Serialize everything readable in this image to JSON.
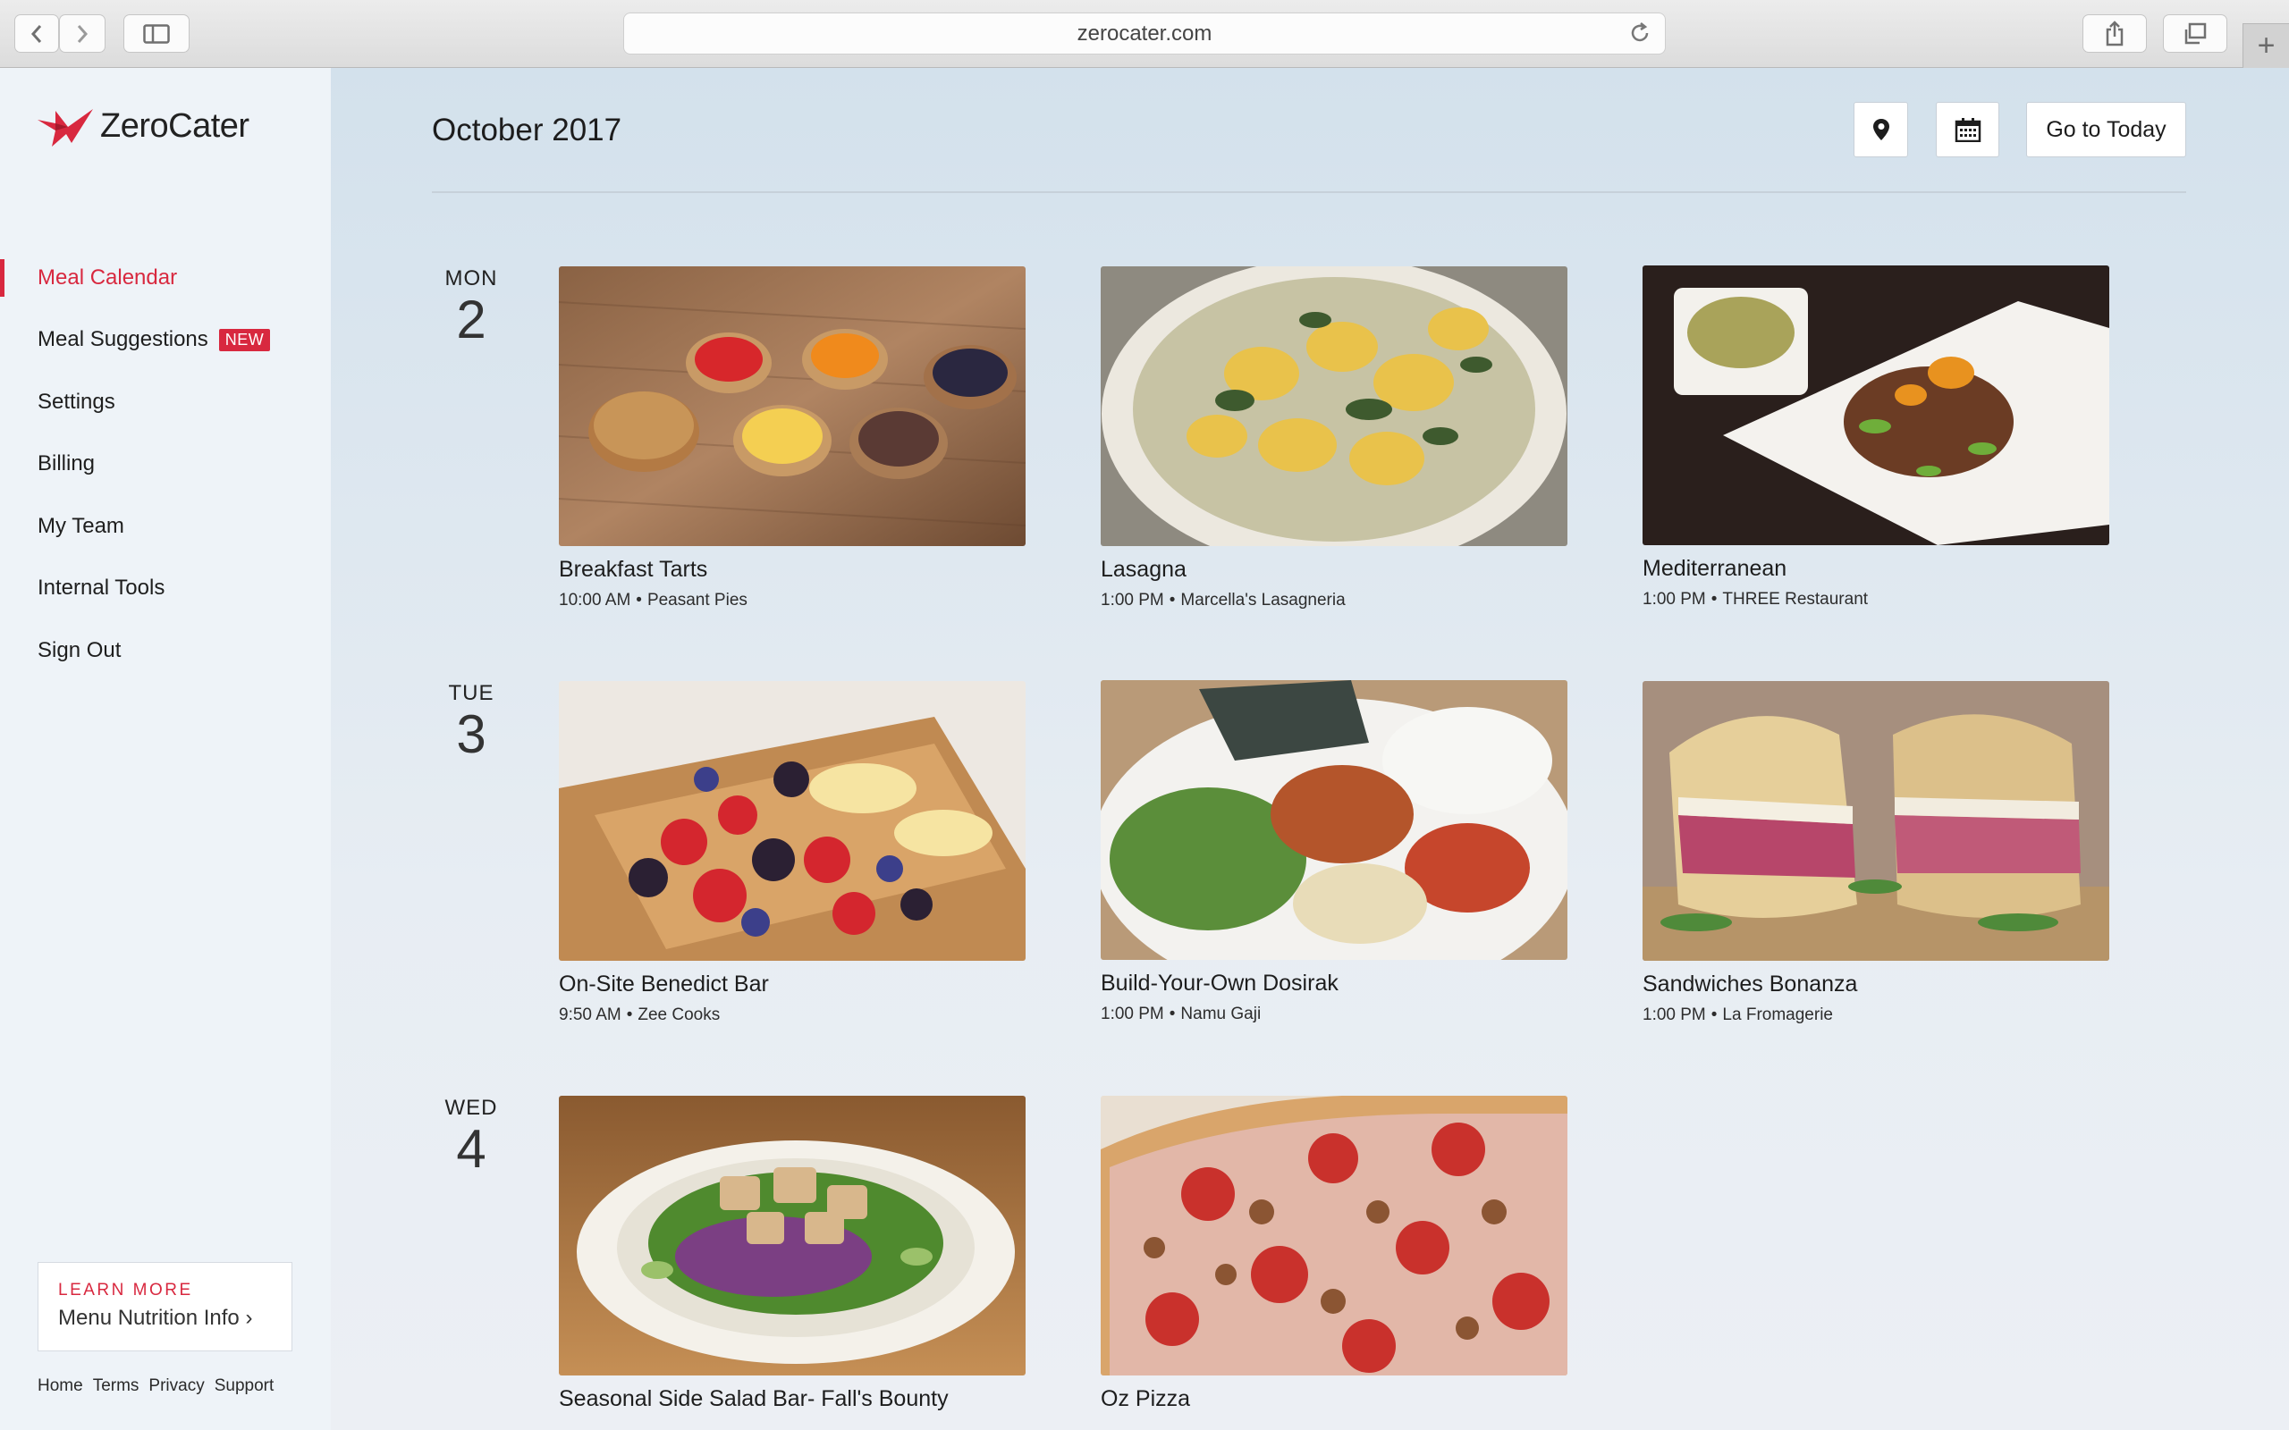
{
  "browser": {
    "url": "zerocater.com"
  },
  "brand": {
    "name": "ZeroCater",
    "accent": "#d8283f"
  },
  "sidebar": {
    "items": [
      {
        "label": "Meal Calendar",
        "active": true
      },
      {
        "label": "Meal Suggestions",
        "badge": "NEW"
      },
      {
        "label": "Settings"
      },
      {
        "label": "Billing"
      },
      {
        "label": "My Team"
      },
      {
        "label": "Internal Tools"
      },
      {
        "label": "Sign Out"
      }
    ],
    "promo": {
      "kicker": "LEARN MORE",
      "link": "Menu Nutrition Info ›"
    },
    "footer": [
      "Home",
      "Terms",
      "Privacy",
      "Support"
    ]
  },
  "header": {
    "title": "October 2017",
    "location_icon": "map-pin-icon",
    "calendar_icon": "calendar-icon",
    "today_label": "Go to Today"
  },
  "days": [
    {
      "dow": "MON",
      "num": "2",
      "meals": [
        {
          "name": "Breakfast Tarts",
          "time": "10:00 AM",
          "vendor": "Peasant Pies",
          "photo": "tarts"
        },
        {
          "name": "Lasagna",
          "time": "1:00 PM",
          "vendor": "Marcella's Lasagneria",
          "photo": "lasagna"
        },
        {
          "name": "Mediterranean",
          "time": "1:00 PM",
          "vendor": "THREE Restaurant",
          "photo": "mediterranean"
        }
      ]
    },
    {
      "dow": "TUE",
      "num": "3",
      "meals": [
        {
          "name": "On-Site Benedict Bar",
          "time": "9:50 AM",
          "vendor": "Zee Cooks",
          "photo": "crepe"
        },
        {
          "name": "Build-Your-Own Dosirak",
          "time": "1:00 PM",
          "vendor": "Namu Gaji",
          "photo": "dosirak"
        },
        {
          "name": "Sandwiches Bonanza",
          "time": "1:00 PM",
          "vendor": "La Fromagerie",
          "photo": "sandwich"
        }
      ]
    },
    {
      "dow": "WED",
      "num": "4",
      "meals": [
        {
          "name": "Seasonal Side Salad Bar- Fall's Bounty",
          "time": "",
          "vendor": "",
          "photo": "salad"
        },
        {
          "name": "Oz Pizza",
          "time": "",
          "vendor": "",
          "photo": "pizza"
        }
      ]
    }
  ]
}
